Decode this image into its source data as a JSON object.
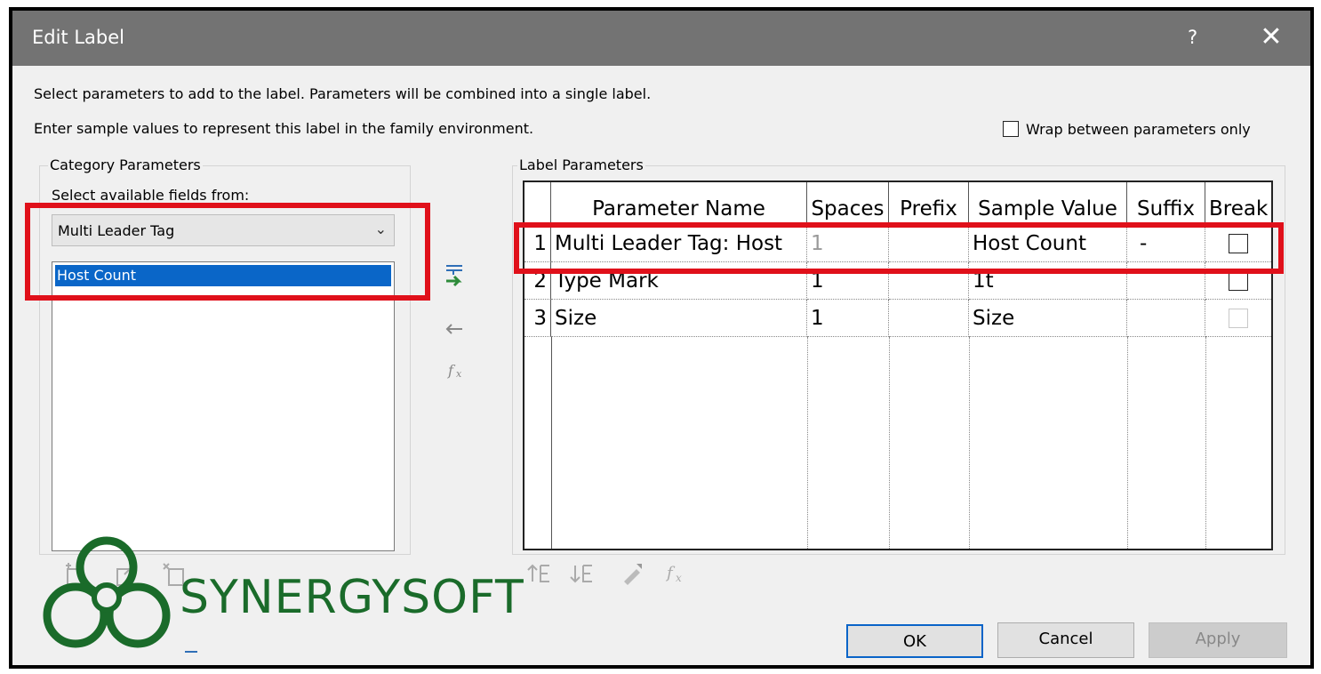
{
  "dialog": {
    "title": "Edit Label",
    "help_label": "?",
    "close_label": "✕"
  },
  "instructions": {
    "line1": "Select parameters to add to the label.  Parameters will be combined into a single label.",
    "line2": "Enter sample values to represent this label in the family environment."
  },
  "wrap_option": {
    "label": "Wrap between parameters only",
    "checked": false
  },
  "category_parameters": {
    "legend": "Category Parameters",
    "select_label": "Select available fields from:",
    "selected_category": "Multi Leader Tag",
    "fields": [
      "Host Count"
    ],
    "selected_field": "Host Count"
  },
  "label_parameters": {
    "legend": "Label Parameters",
    "columns": [
      "Parameter Name",
      "Spaces",
      "Prefix",
      "Sample Value",
      "Suffix",
      "Break"
    ],
    "rows": [
      {
        "num": "1",
        "name": "Multi Leader Tag: Host",
        "spaces": "1",
        "prefix": "",
        "sample": "Host Count",
        "suffix": "-",
        "break": false
      },
      {
        "num": "2",
        "name": "Type Mark",
        "spaces": "1",
        "prefix": "",
        "sample": "1t",
        "suffix": "",
        "break": false
      },
      {
        "num": "3",
        "name": "Size",
        "spaces": "1",
        "prefix": "",
        "sample": "Size",
        "suffix": "",
        "break": false
      }
    ]
  },
  "buttons": {
    "ok": "OK",
    "cancel": "Cancel",
    "apply": "Apply"
  },
  "watermark": {
    "text": "SYNERGYSOFT",
    "color": "#1a6b2a"
  },
  "colors": {
    "titlebar": "#737373",
    "highlight": "#e0101a",
    "selection": "#0a66c8"
  }
}
